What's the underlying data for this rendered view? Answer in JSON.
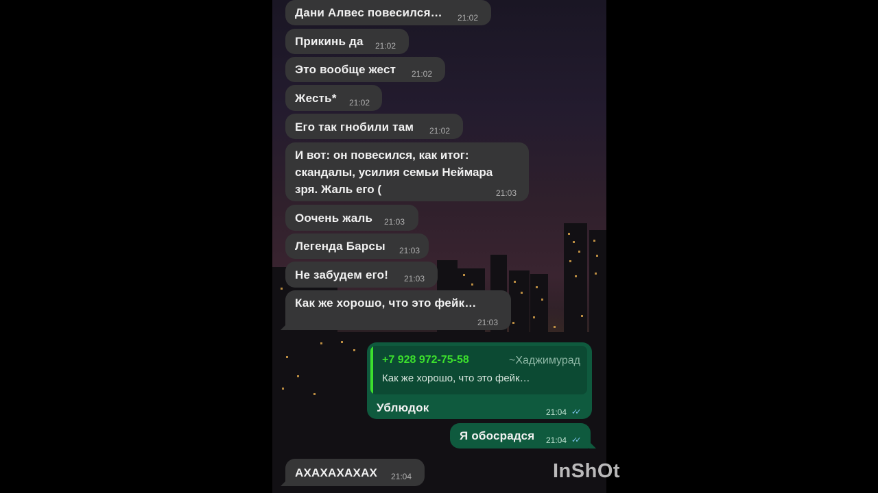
{
  "chat": {
    "messages": [
      {
        "text": "Дани Алвес повесился…",
        "time": "21:02"
      },
      {
        "text": "Прикинь да",
        "time": "21:02"
      },
      {
        "text": "Это вообще жест",
        "time": "21:02"
      },
      {
        "text": "Жесть*",
        "time": "21:02"
      },
      {
        "text": "Его так гнобили там",
        "time": "21:02"
      },
      {
        "lines": [
          "И вот: он повесился, как итог:",
          "скандалы, усилия семьи Неймара",
          "зря. Жаль его ("
        ],
        "time": "21:03"
      },
      {
        "text": "Оочень жаль",
        "time": "21:03"
      },
      {
        "text": "Легенда Барсы",
        "time": "21:03"
      },
      {
        "text": "Не забудем его!",
        "time": "21:03"
      },
      {
        "text": "Как же хорошо, что это фейк…",
        "time": "21:03"
      }
    ],
    "reply": {
      "quote_phone": "+7 928 972-75-58",
      "quote_name": "~Хаджимурад",
      "quote_text": "Как же хорошо, что это фейк…",
      "text": "Ублюдок",
      "time": "21:04"
    },
    "outgoing": {
      "text": "Я обосрадся",
      "time": "21:04"
    },
    "last": {
      "text": "АХАХАХАХАХ",
      "time": "21:04"
    },
    "read_ticks": "✓✓"
  },
  "watermark": "InShOt",
  "colors": {
    "incoming_bubble": "#363637",
    "outgoing_bubble": "#0f5a3e",
    "quote_accent": "#3ce02d",
    "read_ticks": "#7fc7f2"
  }
}
